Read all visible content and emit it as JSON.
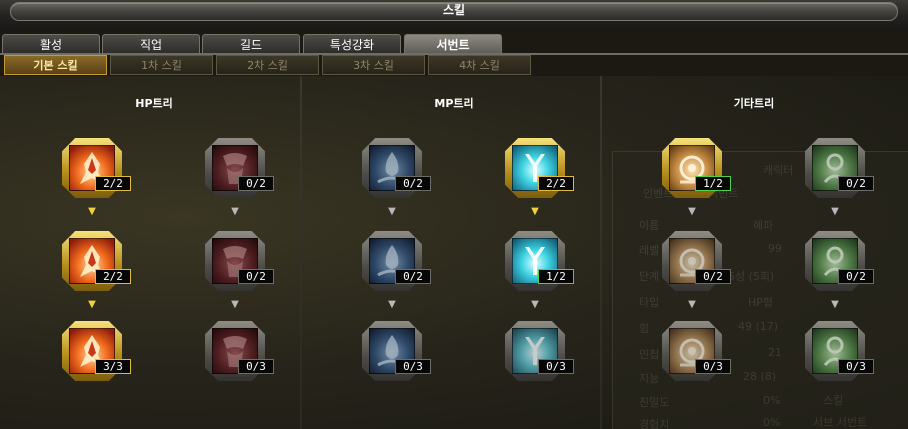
{
  "window": {
    "title": "스킬"
  },
  "tabs": [
    "활성",
    "직업",
    "길드",
    "특성강화",
    "서번트"
  ],
  "active_tab": "서번트",
  "subtabs": [
    "기본 스킬",
    "1차 스킬",
    "2차 스킬",
    "3차 스킬",
    "4차 스킬"
  ],
  "active_subtab": "기본 스킬",
  "trees": [
    {
      "title": "HP트리",
      "columns": [
        [
          {
            "level": "2/2",
            "learned": true,
            "theme": "fire"
          },
          {
            "level": "2/2",
            "learned": true,
            "theme": "fire"
          },
          {
            "level": "3/3",
            "learned": true,
            "theme": "fire"
          }
        ],
        [
          {
            "level": "0/2",
            "learned": false,
            "theme": "blood"
          },
          {
            "level": "0/2",
            "learned": false,
            "theme": "blood"
          },
          {
            "level": "0/3",
            "learned": false,
            "theme": "blood"
          }
        ]
      ]
    },
    {
      "title": "MP트리",
      "columns": [
        [
          {
            "level": "0/2",
            "learned": false,
            "theme": "blue"
          },
          {
            "level": "0/2",
            "learned": false,
            "theme": "blue"
          },
          {
            "level": "0/3",
            "learned": false,
            "theme": "blue"
          }
        ],
        [
          {
            "level": "2/2",
            "learned": true,
            "theme": "cyan"
          },
          {
            "level": "1/2",
            "learned": true,
            "partial": true,
            "theme": "cyan"
          },
          {
            "level": "0/3",
            "learned": false,
            "theme": "cyan"
          }
        ]
      ]
    },
    {
      "title": "기타트리",
      "columns": [
        [
          {
            "level": "1/2",
            "learned": true,
            "partial": true,
            "theme": "sand"
          },
          {
            "level": "0/2",
            "learned": false,
            "theme": "sand"
          },
          {
            "level": "0/3",
            "learned": false,
            "theme": "sand"
          }
        ],
        [
          {
            "level": "0/2",
            "learned": false,
            "theme": "green"
          },
          {
            "level": "0/2",
            "learned": false,
            "theme": "green"
          },
          {
            "level": "0/3",
            "learned": false,
            "theme": "green"
          }
        ]
      ]
    }
  ],
  "arrow_glyph": "▼",
  "background_panel": {
    "labels": [
      "캐릭터",
      "인벤트",
      "서번트",
      "이름",
      "레벨",
      "단계",
      "타입",
      "힘",
      "민첩",
      "지능",
      "친밀도",
      "경험치"
    ],
    "values": [
      "혜파",
      "99",
      "5성 (5회)",
      "HP형",
      "49 (17)",
      "21",
      "28 (8)",
      "0%",
      "0%"
    ],
    "footer": [
      "스킬",
      "서브 서번트"
    ]
  },
  "colors": {
    "gold_accent": "#f2d23c",
    "partial_border": "#4fd14a"
  }
}
